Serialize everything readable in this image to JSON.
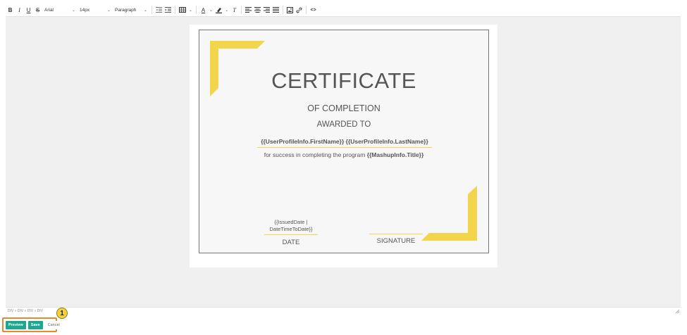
{
  "toolbar": {
    "bold": "B",
    "italic": "I",
    "underline": "U",
    "strike": "S",
    "font_family": "Arial",
    "font_size": "14px",
    "block_format": "Paragraph",
    "text_color_label": "A",
    "clear_format_label": "T",
    "source_code": "<>"
  },
  "certificate": {
    "title": "CERTIFICATE",
    "subtitle": "OF COMPLETION",
    "awarded": "AWARDED TO",
    "name": "{{UserProfileInfo.FirstName}} {{UserProfileInfo.LastName}}",
    "line_prefix": "for success in completing the program ",
    "line_variable": "{{MashupInfo.Title}}",
    "date_value_line1": "{{IssuedDate |",
    "date_value_line2": "DateTimeToDate}}",
    "date_label": "DATE",
    "signature_label": "SIGNATURE",
    "accent_color": "#f2d54a"
  },
  "statusbar": {
    "path": "DIV » DIV » DIV » DIV"
  },
  "actions": {
    "preview": "Preview",
    "save": "Save",
    "cancel": "Cancel",
    "callout_number": "1",
    "highlight_color": "#e8892b",
    "button_color": "#1ea68e"
  }
}
